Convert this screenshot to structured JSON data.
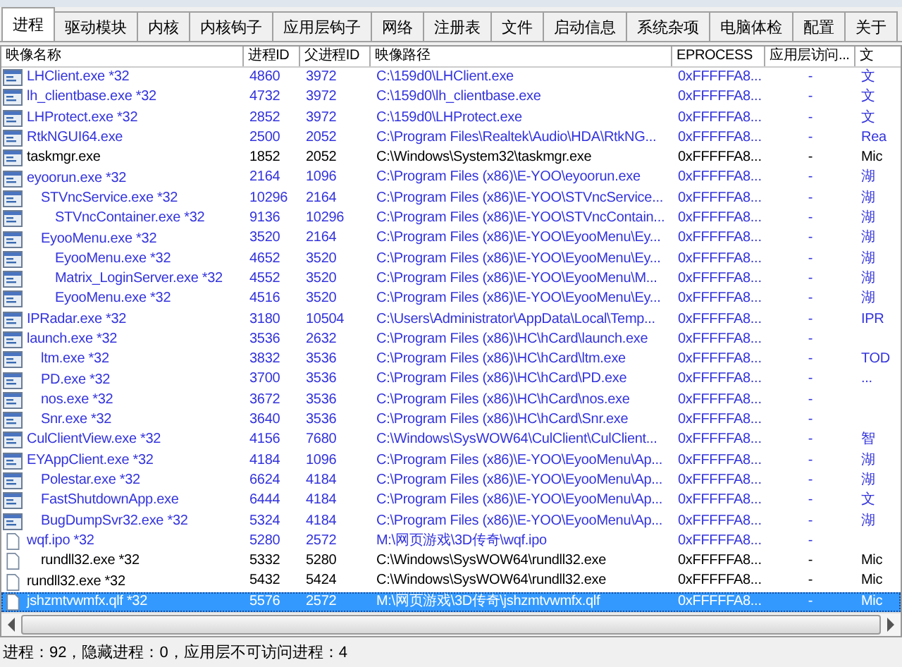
{
  "tabs": [
    {
      "label": "进程",
      "selected": true
    },
    {
      "label": "驱动模块",
      "selected": false
    },
    {
      "label": "内核",
      "selected": false
    },
    {
      "label": "内核钩子",
      "selected": false
    },
    {
      "label": "应用层钩子",
      "selected": false
    },
    {
      "label": "网络",
      "selected": false
    },
    {
      "label": "注册表",
      "selected": false
    },
    {
      "label": "文件",
      "selected": false
    },
    {
      "label": "启动信息",
      "selected": false
    },
    {
      "label": "系统杂项",
      "selected": false
    },
    {
      "label": "电脑体检",
      "selected": false
    },
    {
      "label": "配置",
      "selected": false
    },
    {
      "label": "关于",
      "selected": false
    }
  ],
  "table": {
    "columns": [
      "映像名称",
      "进程ID",
      "父进程ID",
      "映像路径",
      "EPROCESS",
      "应用层访问...",
      "文"
    ],
    "rows": [
      {
        "name": "LHClient.exe *32",
        "pid": "4860",
        "ppid": "3972",
        "path": "C:\\159d0\\LHClient.exe",
        "eprocess": "0xFFFFFA8...",
        "access": "-",
        "column_8": "文",
        "color": "#3333dd",
        "kind": "window",
        "selected": false
      },
      {
        "name": "lh_clientbase.exe *32",
        "pid": "4732",
        "ppid": "3972",
        "path": "C:\\159d0\\lh_clientbase.exe",
        "eprocess": "0xFFFFFA8...",
        "access": "-",
        "column_8": "文",
        "color": "#3333dd",
        "kind": "window",
        "selected": false
      },
      {
        "name": "LHProtect.exe *32",
        "pid": "2852",
        "ppid": "3972",
        "path": "C:\\159d0\\LHProtect.exe",
        "eprocess": "0xFFFFFA8...",
        "access": "-",
        "column_8": "文",
        "color": "#3333dd",
        "kind": "window",
        "selected": false
      },
      {
        "name": "RtkNGUI64.exe",
        "pid": "2500",
        "ppid": "2052",
        "path": "C:\\Program Files\\Realtek\\Audio\\HDA\\RtkNG...",
        "eprocess": "0xFFFFFA8...",
        "access": "-",
        "column_8": "Rea",
        "color": "#3333dd",
        "kind": "window",
        "selected": false
      },
      {
        "name": "taskmgr.exe",
        "pid": "1852",
        "ppid": "2052",
        "path": "C:\\Windows\\System32\\taskmgr.exe",
        "eprocess": "0xFFFFFA8...",
        "access": "-",
        "column_8": "Mic",
        "color": "#000000",
        "kind": "window",
        "selected": false
      },
      {
        "name": "eyoorun.exe *32",
        "pid": "2164",
        "ppid": "1096",
        "path": "C:\\Program Files (x86)\\E-YOO\\eyoorun.exe",
        "eprocess": "0xFFFFFA8...",
        "access": "-",
        "column_8": "湖",
        "color": "#3333dd",
        "kind": "window",
        "selected": false,
        "children": [
          {
            "name": "STVncService.exe *32",
            "pid": "10296",
            "ppid": "2164",
            "path": "C:\\Program Files (x86)\\E-YOO\\STVncService...",
            "eprocess": "0xFFFFFA8...",
            "access": "-",
            "column_8": "湖",
            "color": "#3333dd",
            "kind": "window",
            "selected": false,
            "children": [
              {
                "name": "STVncContainer.exe *32",
                "pid": "9136",
                "ppid": "10296",
                "path": "C:\\Program Files (x86)\\E-YOO\\STVncContain...",
                "eprocess": "0xFFFFFA8...",
                "access": "-",
                "column_8": "湖",
                "color": "#3333dd",
                "kind": "window",
                "selected": false
              }
            ]
          },
          {
            "name": "EyooMenu.exe *32",
            "pid": "3520",
            "ppid": "2164",
            "path": "C:\\Program Files (x86)\\E-YOO\\EyooMenu\\Ey...",
            "eprocess": "0xFFFFFA8...",
            "access": "-",
            "column_8": "湖",
            "color": "#3333dd",
            "kind": "window",
            "selected": false,
            "children": [
              {
                "name": "EyooMenu.exe *32",
                "pid": "4652",
                "ppid": "3520",
                "path": "C:\\Program Files (x86)\\E-YOO\\EyooMenu\\Ey...",
                "eprocess": "0xFFFFFA8...",
                "access": "-",
                "column_8": "湖",
                "color": "#3333dd",
                "kind": "window",
                "selected": false
              },
              {
                "name": "Matrix_LoginServer.exe *32",
                "pid": "4552",
                "ppid": "3520",
                "path": "C:\\Program Files (x86)\\E-YOO\\EyooMenu\\M...",
                "eprocess": "0xFFFFFA8...",
                "access": "-",
                "column_8": "湖",
                "color": "#3333dd",
                "kind": "window",
                "selected": false
              },
              {
                "name": "EyooMenu.exe *32",
                "pid": "4516",
                "ppid": "3520",
                "path": "C:\\Program Files (x86)\\E-YOO\\EyooMenu\\Ey...",
                "eprocess": "0xFFFFFA8...",
                "access": "-",
                "column_8": "湖",
                "color": "#3333dd",
                "kind": "window",
                "selected": false
              }
            ]
          }
        ]
      },
      {
        "name": "IPRadar.exe *32",
        "pid": "3180",
        "ppid": "10504",
        "path": "C:\\Users\\Administrator\\AppData\\Local\\Temp...",
        "eprocess": "0xFFFFFA8...",
        "access": "-",
        "column_8": "IPR",
        "color": "#3333dd",
        "kind": "window",
        "selected": false
      },
      {
        "name": "launch.exe *32",
        "pid": "3536",
        "ppid": "2632",
        "path": "C:\\Program Files (x86)\\HC\\hCard\\launch.exe",
        "eprocess": "0xFFFFFA8...",
        "access": "-",
        "color": "#3333dd",
        "kind": "window",
        "selected": false,
        "children": [
          {
            "name": "ltm.exe *32",
            "pid": "3832",
            "ppid": "3536",
            "path": "C:\\Program Files (x86)\\HC\\hCard\\ltm.exe",
            "eprocess": "0xFFFFFA8...",
            "access": "-",
            "column_8": "TOD",
            "color": "#3333dd",
            "kind": "window",
            "selected": false
          },
          {
            "name": "PD.exe *32",
            "pid": "3700",
            "ppid": "3536",
            "path": "C:\\Program Files (x86)\\HC\\hCard\\PD.exe",
            "eprocess": "0xFFFFFA8...",
            "access": "-",
            "column_8": "...",
            "color": "#3333dd",
            "kind": "window",
            "selected": false
          },
          {
            "name": "nos.exe *32",
            "pid": "3672",
            "ppid": "3536",
            "path": "C:\\Program Files (x86)\\HC\\hCard\\nos.exe",
            "eprocess": "0xFFFFFA8...",
            "access": "-",
            "color": "#3333dd",
            "kind": "window",
            "selected": false
          },
          {
            "name": "Snr.exe *32",
            "pid": "3640",
            "ppid": "3536",
            "path": "C:\\Program Files (x86)\\HC\\hCard\\Snr.exe",
            "eprocess": "0xFFFFFA8...",
            "access": "-",
            "color": "#3333dd",
            "kind": "window",
            "selected": false
          }
        ]
      },
      {
        "name": "CulClientView.exe *32",
        "pid": "4156",
        "ppid": "7680",
        "path": "C:\\Windows\\SysWOW64\\CulClient\\CulClient...",
        "eprocess": "0xFFFFFA8...",
        "access": "-",
        "column_8": "智",
        "color": "#3333dd",
        "kind": "window",
        "selected": false
      },
      {
        "name": "EYAppClient.exe *32",
        "pid": "4184",
        "ppid": "1096",
        "path": "C:\\Program Files (x86)\\E-YOO\\EyooMenu\\Ap...",
        "eprocess": "0xFFFFFA8...",
        "access": "-",
        "column_8": "湖",
        "color": "#3333dd",
        "kind": "window",
        "selected": false,
        "children": [
          {
            "name": "Polestar.exe *32",
            "pid": "6624",
            "ppid": "4184",
            "path": "C:\\Program Files (x86)\\E-YOO\\EyooMenu\\Ap...",
            "eprocess": "0xFFFFFA8...",
            "access": "-",
            "column_8": "湖",
            "color": "#3333dd",
            "kind": "window",
            "selected": false
          },
          {
            "name": "FastShutdownApp.exe",
            "pid": "6444",
            "ppid": "4184",
            "path": "C:\\Program Files (x86)\\E-YOO\\EyooMenu\\Ap...",
            "eprocess": "0xFFFFFA8...",
            "access": "-",
            "column_8": "文",
            "color": "#3333dd",
            "kind": "window",
            "selected": false
          },
          {
            "name": "BugDumpSvr32.exe *32",
            "pid": "5324",
            "ppid": "4184",
            "path": "C:\\Program Files (x86)\\E-YOO\\EyooMenu\\Ap...",
            "eprocess": "0xFFFFFA8...",
            "access": "-",
            "column_8": "湖",
            "color": "#3333dd",
            "kind": "window",
            "selected": false
          }
        ]
      },
      {
        "name": "wqf.ipo *32",
        "pid": "5280",
        "ppid": "2572",
        "path": "M:\\网页游戏\\3D传奇\\wqf.ipo",
        "eprocess": "0xFFFFFA8...",
        "access": "-",
        "color": "#3333dd",
        "kind": "file",
        "selected": false,
        "children": [
          {
            "name": "rundll32.exe *32",
            "pid": "5332",
            "ppid": "5280",
            "path": "C:\\Windows\\SysWOW64\\rundll32.exe",
            "eprocess": "0xFFFFFA8...",
            "access": "-",
            "column_8": "Mic",
            "color": "#000000",
            "kind": "file",
            "selected": false
          }
        ]
      },
      {
        "name": "rundll32.exe *32",
        "pid": "5432",
        "ppid": "5424",
        "path": "C:\\Windows\\SysWOW64\\rundll32.exe",
        "eprocess": "0xFFFFFA8...",
        "access": "-",
        "column_8": "Mic",
        "color": "#000000",
        "kind": "file",
        "selected": false
      },
      {
        "name": "jshzmtvwmfx.qlf *32",
        "pid": "5576",
        "ppid": "2572",
        "path": "M:\\网页游戏\\3D传奇\\jshzmtvwmfx.qlf",
        "eprocess": "0xFFFFFA8...",
        "access": "-",
        "column_8": "Mic",
        "color": "#ffffff",
        "kind": "file",
        "selected": true
      }
    ]
  },
  "status_bar": "进程：92，隐藏进程：0，应用层不可访问进程：4"
}
